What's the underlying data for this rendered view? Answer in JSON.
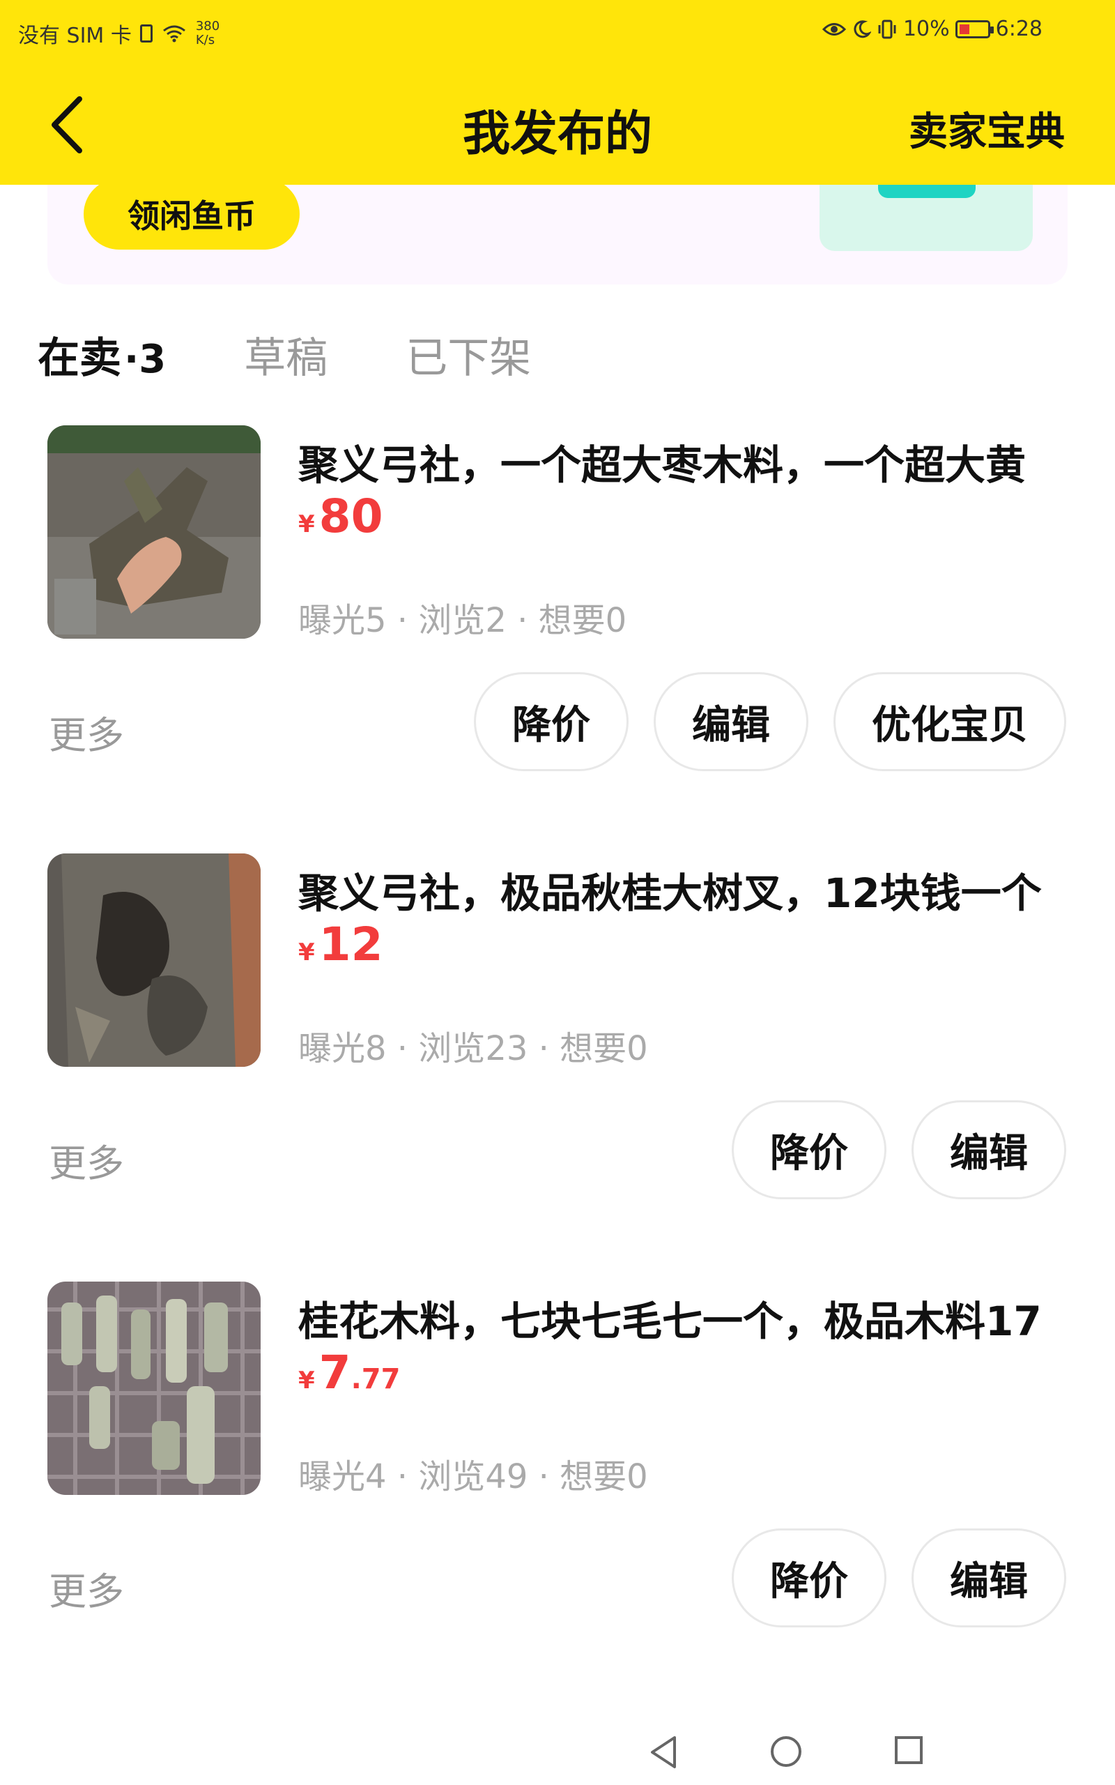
{
  "status_bar": {
    "carrier": "没有 SIM 卡",
    "net_speed_value": "380",
    "net_speed_unit": "K/s",
    "battery": "10%",
    "time": "6:28"
  },
  "header": {
    "title": "我发布的",
    "right_link": "卖家宝典",
    "bg_color": "#ffe50a"
  },
  "promo": {
    "button": "领闲鱼币"
  },
  "tabs": [
    {
      "label": "在卖",
      "count": "·3",
      "active": true
    },
    {
      "label": "草稿",
      "count": "",
      "active": false
    },
    {
      "label": "已下架",
      "count": "",
      "active": false
    }
  ],
  "listings": [
    {
      "title": "聚义弓社，一个超大枣木料，一个超大黄",
      "currency": "¥",
      "price_int": "80",
      "price_dec": "",
      "stats": "曝光5 · 浏览2 · 想要0",
      "more": "更多",
      "actions": [
        "降价",
        "编辑",
        "优化宝贝"
      ]
    },
    {
      "title": "聚义弓社，极品秋桂大树叉，12块钱一个",
      "currency": "¥",
      "price_int": "12",
      "price_dec": "",
      "stats": "曝光8 · 浏览23 · 想要0",
      "more": "更多",
      "actions": [
        "降价",
        "编辑"
      ]
    },
    {
      "title": "桂花木料，七块七毛七一个，极品木料17",
      "currency": "¥",
      "price_int": "7",
      "price_dec": ".77",
      "stats": "曝光4 · 浏览49 · 想要0",
      "more": "更多",
      "actions": [
        "降价",
        "编辑"
      ]
    }
  ],
  "colors": {
    "accent": "#ffe50a",
    "price": "#f23c3c",
    "muted": "#999999"
  }
}
